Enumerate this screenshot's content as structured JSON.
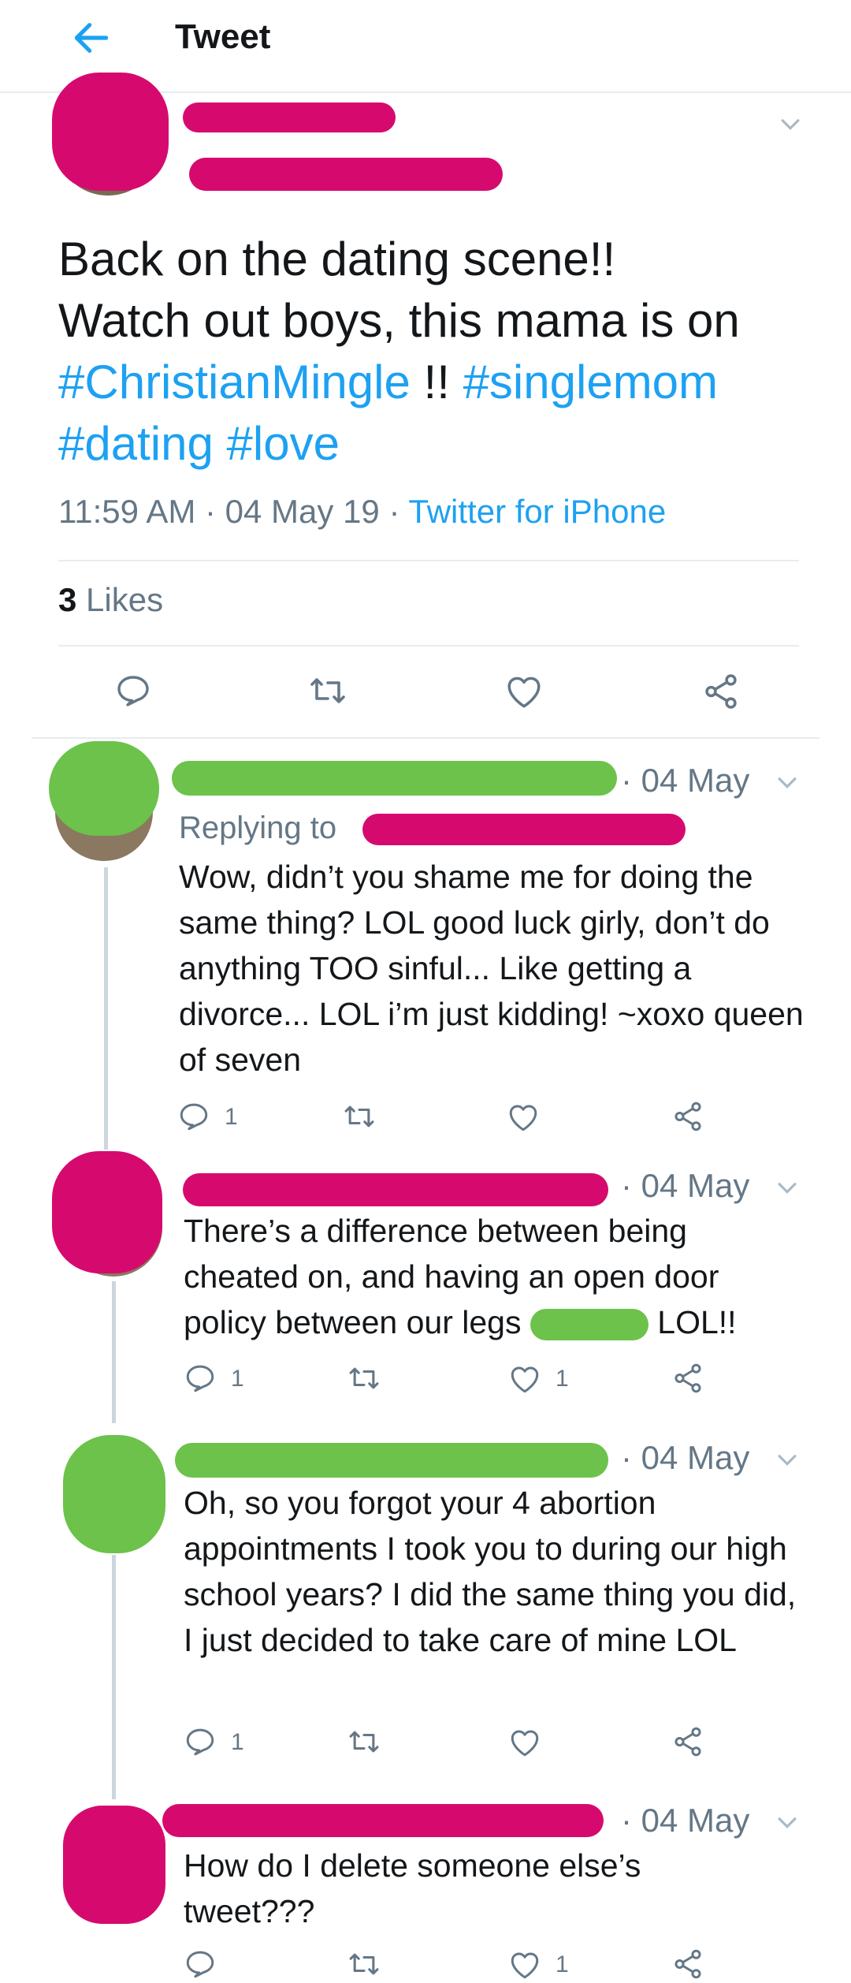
{
  "header": {
    "title": "Tweet"
  },
  "main_tweet": {
    "text_line1": "Back on the dating scene!!",
    "text_line2": "Watch out boys, this mama is on",
    "hashtag1": "#ChristianMingle",
    "separator": " !! ",
    "hashtag2": "#singlemom",
    "hashtag3": "#dating",
    "hashtag4": "#love",
    "time": "11:59 AM",
    "date": "04 May 19",
    "source": "Twitter for iPhone",
    "likes_count": "3",
    "likes_label": "Likes"
  },
  "replies": [
    {
      "date": "· 04 May",
      "replying_label": "Replying to",
      "text": "Wow, didn’t you shame me for doing the same thing? LOL good luck girly, don’t do anything TOO sinful... Like getting a divorce... LOL i’m just kidding! ~xoxo queen of seven",
      "reply_count": "1",
      "like_count": ""
    },
    {
      "date": "· 04 May",
      "text_part1": "There’s a difference between being cheated on, and having an open door policy between our legs",
      "text_part2": "LOL!!",
      "reply_count": "1",
      "like_count": "1"
    },
    {
      "date": "· 04 May",
      "text": "Oh, so you forgot your 4 abortion appointments I took you to during our high school years? I did the same thing you did, I just decided to take care of mine LOL",
      "reply_count": "1",
      "like_count": ""
    },
    {
      "date": "· 04 May",
      "text": "How do I delete someone else’s tweet???",
      "reply_count": "",
      "like_count": "1"
    }
  ],
  "colors": {
    "accent": "#1da1f2",
    "muted": "#657786",
    "redaction_pink": "#d60a6e",
    "redaction_green": "#6cc24a"
  }
}
